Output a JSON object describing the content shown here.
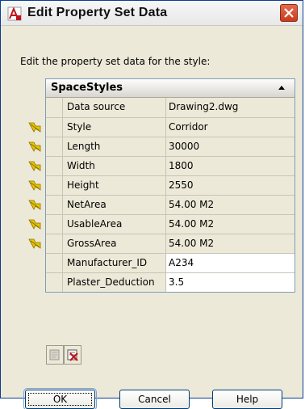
{
  "window": {
    "title": "Edit Property Set Data",
    "icon": "autocad-icon",
    "close_icon": "close-icon"
  },
  "instruction": "Edit the property set data for the style:",
  "property_set": {
    "name": "SpaceStyles",
    "rows": [
      {
        "name": "Data source",
        "value": "Drawing2.dwg",
        "flag": false,
        "editable": false
      },
      {
        "name": "Style",
        "value": "Corridor",
        "flag": true,
        "editable": false
      },
      {
        "name": "Length",
        "value": "30000",
        "flag": true,
        "editable": false
      },
      {
        "name": "Width",
        "value": "1800",
        "flag": true,
        "editable": false
      },
      {
        "name": "Height",
        "value": "2550",
        "flag": true,
        "editable": false
      },
      {
        "name": "NetArea",
        "value": "54.00 M2",
        "flag": true,
        "editable": false
      },
      {
        "name": "UsableArea",
        "value": "54.00 M2",
        "flag": true,
        "editable": false
      },
      {
        "name": "GrossArea",
        "value": "54.00 M2",
        "flag": true,
        "editable": false
      },
      {
        "name": "Manufacturer_ID",
        "value": "A234",
        "flag": false,
        "editable": true
      },
      {
        "name": "Plaster_Deduction",
        "value": "3.5",
        "flag": false,
        "editable": true
      }
    ]
  },
  "toolbar": {
    "add_icon": "add-property-set-icon",
    "remove_icon": "remove-property-set-icon"
  },
  "buttons": {
    "ok": "OK",
    "cancel": "Cancel",
    "help": "Help"
  },
  "colors": {
    "titlebar_border": "#0b3d91",
    "close_button": "#c93b1c",
    "flag_yellow": "#e9c400"
  }
}
